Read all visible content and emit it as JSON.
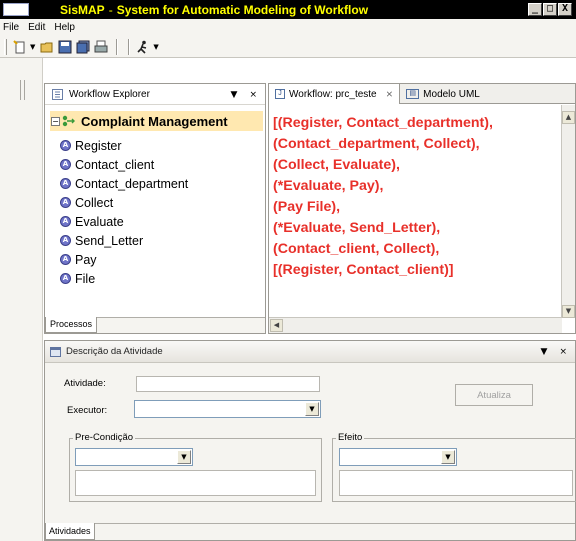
{
  "window": {
    "app_name": "SisMAP",
    "separator": "-",
    "description": "System for Automatic Modeling of Workflow",
    "controls": {
      "minimize": "_",
      "maximize": "□",
      "close": "X"
    }
  },
  "menu": {
    "items": [
      "File",
      "Edit",
      "Help"
    ]
  },
  "toolbar": {
    "icons": [
      "new-file-icon",
      "open-folder-icon",
      "save-icon",
      "save-all-icon",
      "print-icon",
      "run-icon"
    ]
  },
  "explorer": {
    "title": "Workflow Explorer",
    "root": "Complaint Management",
    "items": [
      "Register",
      "Contact_client",
      "Contact_department",
      "Collect",
      "Evaluate",
      "Send_Letter",
      "Pay",
      "File"
    ],
    "footer_tab": "Processos",
    "view_menu_icon": "▼",
    "close_icon": "×"
  },
  "editor": {
    "tabs": [
      {
        "label": "Workflow: prc_teste",
        "close": "⨯",
        "active": true
      },
      {
        "label": "Modelo UML",
        "active": false
      }
    ],
    "lines": [
      "[(Register, Contact_department),",
      "(Contact_department, Collect),",
      "(Collect, Evaluate),",
      "(*Evaluate, Pay),",
      "(Pay File),",
      "(*Evaluate, Send_Letter),",
      "(Contact_client, Collect),",
      "[(Register, Contact_client)]"
    ],
    "text_color": "#e8302a"
  },
  "description_view": {
    "title": "Descrição da Atividade",
    "view_menu_icon": "▼",
    "close_icon": "×",
    "atividade_label": "Atividade:",
    "atividade_value": "",
    "executor_label": "Executor:",
    "executor_value": "",
    "atualiza_button": "Atualiza",
    "precondicao_label": "Pre-Condição",
    "efeito_label": "Efeito",
    "footer_tab": "Atividades"
  }
}
